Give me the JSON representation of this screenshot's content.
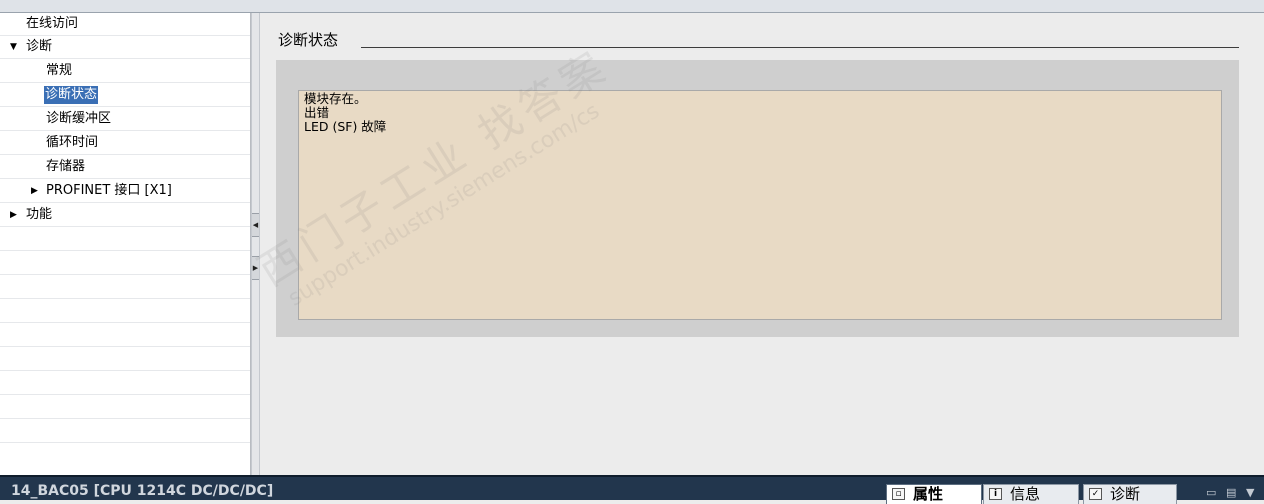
{
  "nav": {
    "items": [
      {
        "label": "在线访问"
      },
      {
        "label": "诊断",
        "expanded": true
      },
      {
        "label": "常规"
      },
      {
        "label": "诊断状态",
        "selected": true
      },
      {
        "label": "诊断缓冲区"
      },
      {
        "label": "循环时间"
      },
      {
        "label": "存储器"
      },
      {
        "label": "PROFINET 接口 [X1]",
        "expanded": false
      },
      {
        "label": "功能",
        "expanded": false
      }
    ]
  },
  "main": {
    "section_title": "诊断状态",
    "status_lines": [
      "模块存在。",
      "出错",
      "LED (SF) 故障"
    ]
  },
  "watermark": {
    "line1": "西门子工业 找答案",
    "line2": "support.industry.siemens.com/cs"
  },
  "statusbar": {
    "device": "14_BAC05 [CPU 1214C DC/DC/DC]",
    "tabs": [
      {
        "label": "属性",
        "icon": "properties-icon",
        "active": true
      },
      {
        "label": "信息",
        "icon": "info-icon",
        "active": false
      },
      {
        "label": "诊断",
        "icon": "diagnostics-icon",
        "active": false
      }
    ]
  }
}
